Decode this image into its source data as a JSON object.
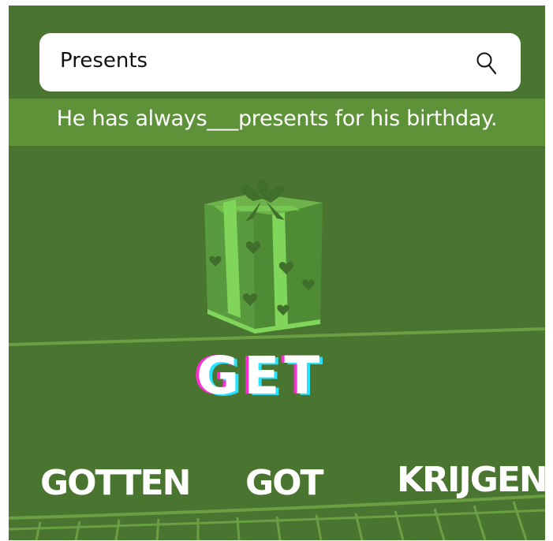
{
  "search": {
    "value": "Presents",
    "icon": "search-icon"
  },
  "prompt": {
    "sentence": "He has always___presents for his birthday."
  },
  "illustration": {
    "icon": "gift-icon"
  },
  "verb": {
    "text": "GET"
  },
  "options": [
    {
      "label": "GOTTEN"
    },
    {
      "label": "GOT"
    },
    {
      "label": "KRIJGEN"
    }
  ],
  "colors": {
    "background": "#4a7530",
    "band": "#5e9239",
    "gift_light": "#7fd65a",
    "gift_mid": "#5a9a3e",
    "glitch_magenta": "#ff2bd6",
    "glitch_cyan": "#27e3ff"
  }
}
